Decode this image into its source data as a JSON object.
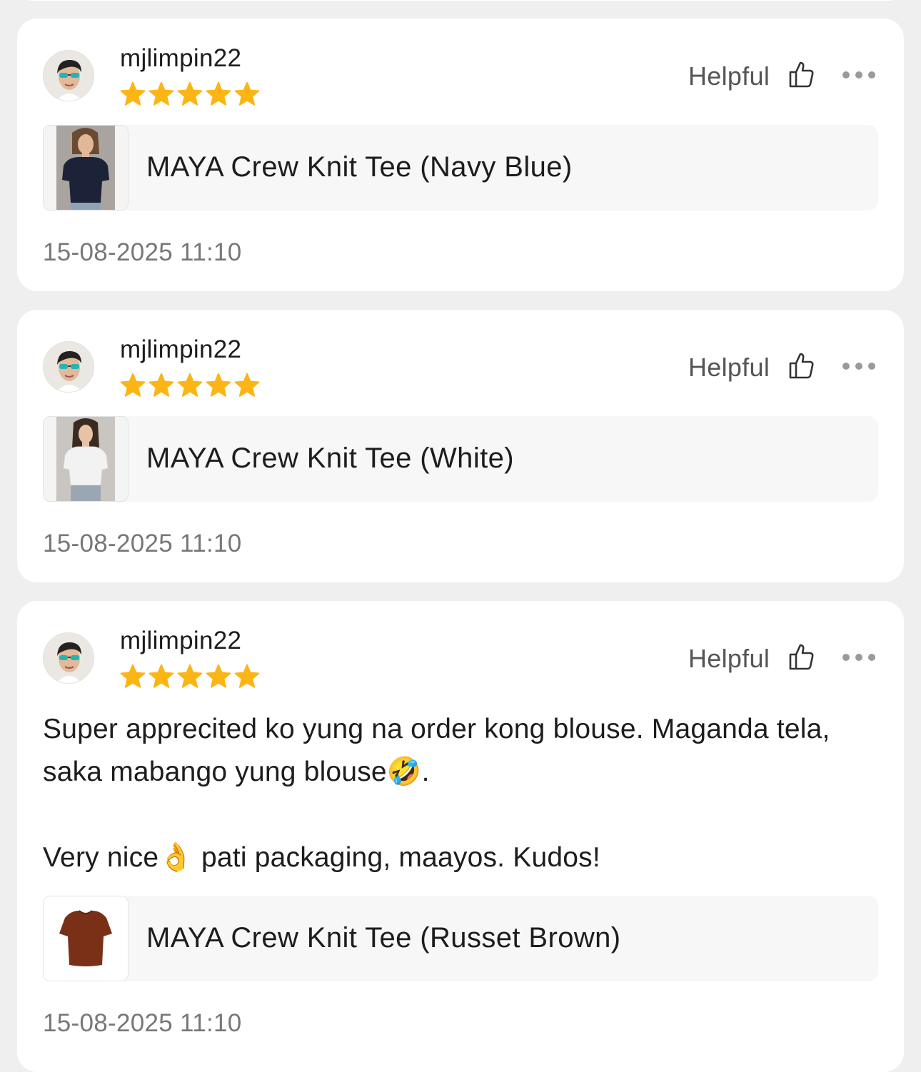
{
  "colors": {
    "star": "#fbb515",
    "background": "#efefef",
    "card": "#ffffff"
  },
  "reviews": [
    {
      "username": "mjlimpin22",
      "rating": 5,
      "helpful_label": "Helpful",
      "text": "",
      "product_name": "MAYA Crew Knit Tee (Navy Blue)",
      "product_color": "#1c2238",
      "date": "15-08-2025 11:10"
    },
    {
      "username": "mjlimpin22",
      "rating": 5,
      "helpful_label": "Helpful",
      "text": "",
      "product_name": "MAYA Crew Knit Tee (White)",
      "product_color": "#e9e9e9",
      "date": "15-08-2025 11:10"
    },
    {
      "username": "mjlimpin22",
      "rating": 5,
      "helpful_label": "Helpful",
      "text": "Super apprecited ko yung na order kong blouse.  Maganda tela, saka mabango yung blouse🤣.\n\nVery nice👌 pati packaging, maayos.  Kudos!",
      "product_name": "MAYA Crew Knit Tee (Russet Brown)",
      "product_color": "#7a3016",
      "date": "15-08-2025 11:10"
    }
  ]
}
